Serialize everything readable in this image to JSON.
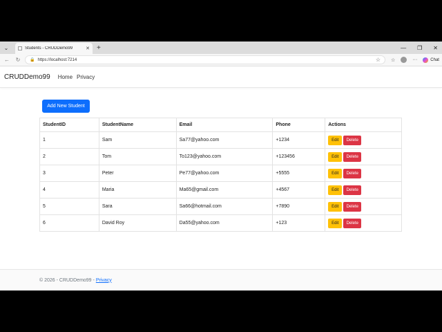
{
  "browser": {
    "tab_title": "Students - CRUDDemo99",
    "url": "https://localhost:7214",
    "chat_label": "Chat"
  },
  "navbar": {
    "brand": "CRUDDemo99",
    "links": [
      "Home",
      "Privacy"
    ]
  },
  "main": {
    "add_button": "Add New Student",
    "columns": [
      "StudentID",
      "StudentName",
      "Email",
      "Phone",
      "Actions"
    ],
    "rows": [
      {
        "id": "1",
        "name": "Sam",
        "email": "Sa77@yahoo.com",
        "phone": "+1234"
      },
      {
        "id": "2",
        "name": "Tom",
        "email": "To123@yahoo.com",
        "phone": "+123456"
      },
      {
        "id": "3",
        "name": "Peter",
        "email": "Pe77@yahoo.com",
        "phone": "+5555"
      },
      {
        "id": "4",
        "name": "Maria",
        "email": "Ma65@gmail.com",
        "phone": "+4567"
      },
      {
        "id": "5",
        "name": "Sara",
        "email": "Sa66@hotmail.com",
        "phone": "+7890"
      },
      {
        "id": "6",
        "name": "David Roy",
        "email": "Da55@yahoo.com",
        "phone": "+123"
      }
    ],
    "edit_label": "Edit",
    "delete_label": "Delete"
  },
  "footer": {
    "text": "© 2026 - CRUDDemo99 - ",
    "privacy_link": "Privacy"
  },
  "colors": {
    "primary": "#0d6efd",
    "warning": "#ffc107",
    "danger": "#dc3545"
  }
}
